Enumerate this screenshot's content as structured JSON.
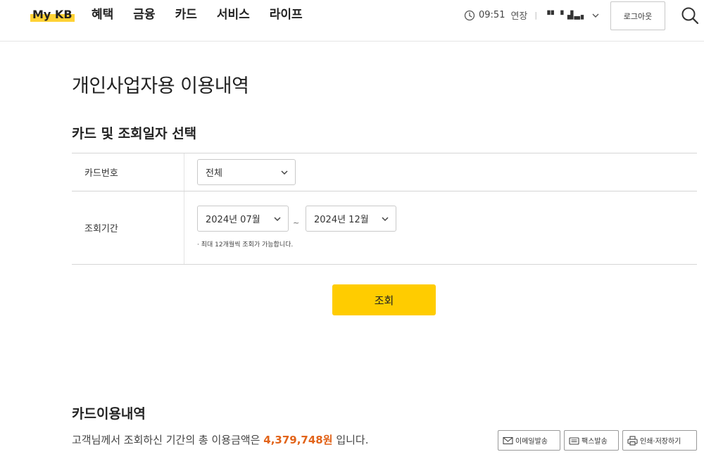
{
  "header": {
    "logo": "My KB",
    "nav": [
      "혜택",
      "금융",
      "카드",
      "서비스",
      "라이프"
    ],
    "session_time": "09:51",
    "session_extend": "연장",
    "user_name": "▝▘▝ ▟▃▖",
    "logout": "로그아웃",
    "icons": [
      "clock-icon",
      "chevron-down-icon",
      "search-icon"
    ]
  },
  "page": {
    "title": "개인사업자용 이용내역",
    "section_title": "카드 및 조회일자 선택"
  },
  "form": {
    "card_label": "카드번호",
    "card_value": "전체",
    "period_label": "조회기간",
    "period_from": "2024년 07월",
    "period_to": "2024년 12월",
    "period_sep": "~",
    "hint": "· 최대 12개월씩 조회가 가능합니다."
  },
  "search_button": "조회",
  "usage": {
    "title": "카드이용내역",
    "summary_prefix": "고객님께서 조회하신 기간의 총 이용금액은",
    "amount": "4,379,748원",
    "summary_suffix": "입니다.",
    "amount_color": "#e2641a"
  },
  "actions": {
    "email": "이메일발송",
    "fax": "팩스발송",
    "print": "인쇄·저장하기"
  },
  "colors": {
    "accent": "#ffcc00",
    "logo_highlight": "#ffd235"
  }
}
